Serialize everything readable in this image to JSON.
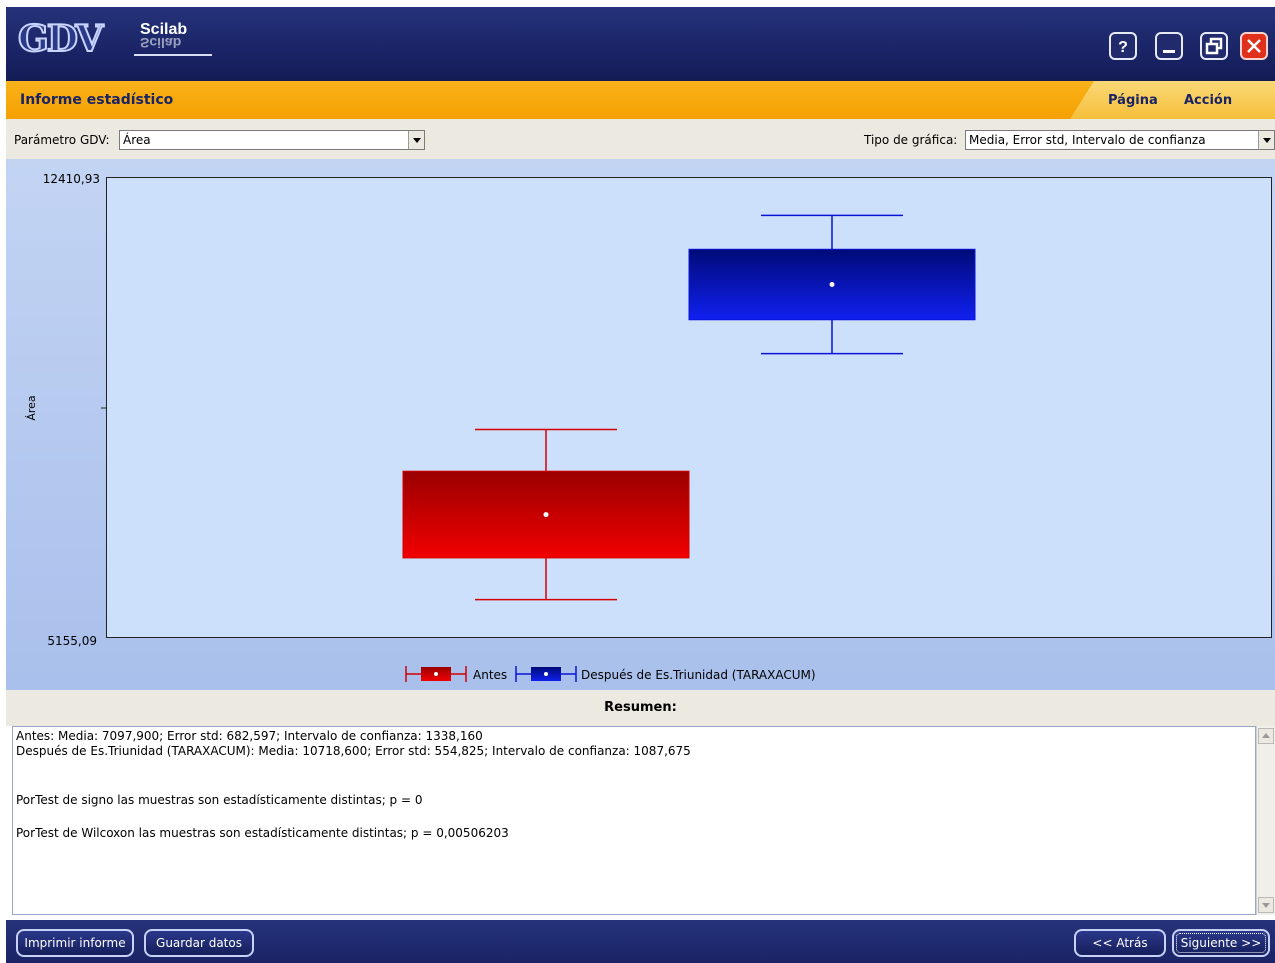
{
  "app": {
    "logo_text": "GDV",
    "brand": "Scilab"
  },
  "window_buttons": {
    "help": "?",
    "minimize": "minimize",
    "maximize": "restore",
    "close": "close"
  },
  "header": {
    "title": "Informe estadístico",
    "menu": [
      "Página",
      "Acción"
    ]
  },
  "controls": {
    "param_label": "Parámetro GDV:",
    "param_value": "Área",
    "chart_type_label": "Tipo de gráfica:",
    "chart_type_value": "Media, Error std, Intervalo de confianza"
  },
  "chart_data": {
    "type": "box",
    "ylabel": "Área",
    "ylim": [
      5155.09,
      12410.93
    ],
    "y_tick_labels": [
      "12410,93",
      "5155,09"
    ],
    "series": [
      {
        "name": "Antes",
        "color": "#d40000",
        "mean": 7097.9,
        "std_error": 682.597,
        "ci": 1338.16
      },
      {
        "name": "Después de Es.Triunidad (TARAXACUM)",
        "color": "#0a14d8",
        "mean": 10718.6,
        "std_error": 554.825,
        "ci": 1087.675
      }
    ],
    "legend_position": "bottom"
  },
  "summary": {
    "heading": "Resumen:",
    "lines": [
      "Antes: Media: 7097,900; Error std: 682,597; Intervalo de confianza: 1338,160",
      "Después de Es.Triunidad (TARAXACUM): Media: 10718,600; Error std: 554,825; Intervalo de confianza: 1087,675",
      "PorTest de signo las muestras son estadísticamente distintas; p = 0",
      "PorTest de Wilcoxon las muestras son estadísticamente distintas; p = 0,00506203"
    ]
  },
  "footer": {
    "print": "Imprimir informe",
    "save": "Guardar datos",
    "back": "<< Atrás",
    "next": "Siguiente >>"
  }
}
